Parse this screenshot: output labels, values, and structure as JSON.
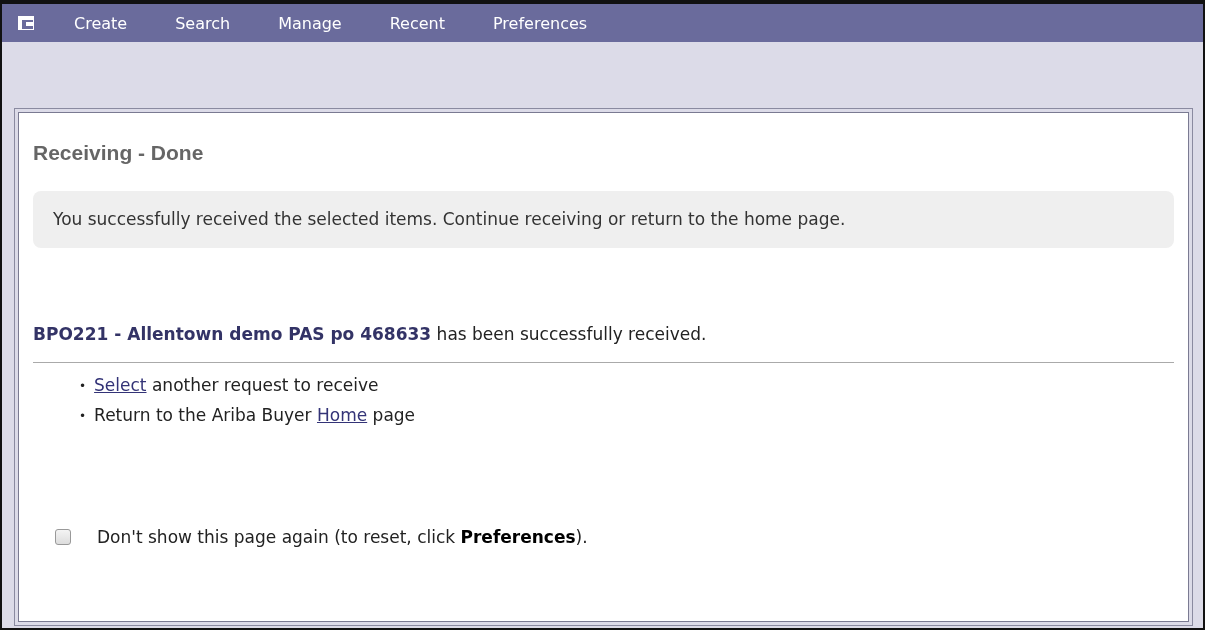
{
  "menu": [
    {
      "label": "Create"
    },
    {
      "label": "Search"
    },
    {
      "label": "Manage"
    },
    {
      "label": "Recent"
    },
    {
      "label": "Preferences"
    }
  ],
  "panel": {
    "title": "Receiving - Done",
    "message": "You successfully received the selected items. Continue receiving or return to the home page.",
    "result": {
      "reference": "BPO221 - Allentown demo PAS po 468633",
      "text": " has been successfully received."
    },
    "actions": [
      {
        "bullet": "•",
        "link": "Select",
        "after": " another request to receive"
      },
      {
        "bullet": "•",
        "before": "Return to the Ariba Buyer ",
        "link": "Home",
        "after": " page"
      }
    ],
    "dont_show": {
      "label": "Don't show this page again (to reset, click **Preferences**).",
      "checked": false
    }
  }
}
